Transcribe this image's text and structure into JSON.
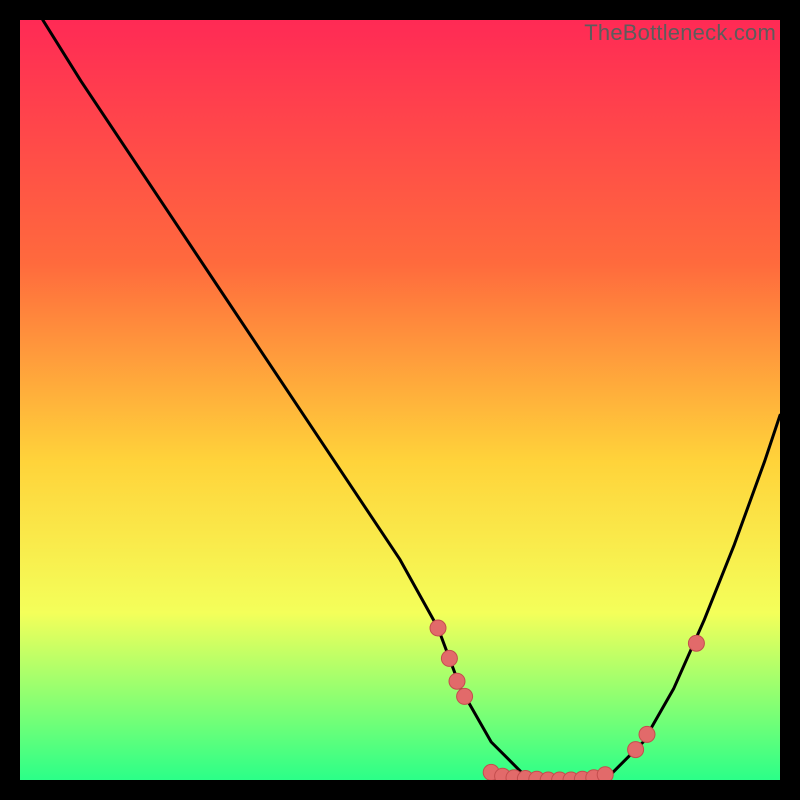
{
  "watermark": "TheBottleneck.com",
  "colors": {
    "bg_black": "#000000",
    "grad_top": "#ff2a55",
    "grad_mid1": "#ff6a3d",
    "grad_mid2": "#ffd33a",
    "grad_mid3": "#f4ff5a",
    "grad_bot": "#2bff88",
    "curve": "#000000",
    "marker_fill": "#e26a6a",
    "marker_stroke": "#c44d4d"
  },
  "chart_data": {
    "type": "line",
    "title": "",
    "xlabel": "",
    "ylabel": "",
    "xlim": [
      0,
      100
    ],
    "ylim": [
      0,
      100
    ],
    "grid": false,
    "curve": {
      "name": "bottleneck-curve",
      "x": [
        3,
        8,
        14,
        20,
        26,
        32,
        38,
        44,
        50,
        55,
        58,
        62,
        66,
        70,
        74,
        78,
        82,
        86,
        90,
        94,
        98,
        100
      ],
      "y": [
        100,
        92,
        83,
        74,
        65,
        56,
        47,
        38,
        29,
        20,
        12,
        5,
        1,
        0,
        0,
        1,
        5,
        12,
        21,
        31,
        42,
        48
      ]
    },
    "flat_region_x": [
      62,
      78
    ],
    "markers": [
      {
        "x": 55,
        "y": 20
      },
      {
        "x": 56.5,
        "y": 16
      },
      {
        "x": 57.5,
        "y": 13
      },
      {
        "x": 58.5,
        "y": 11
      },
      {
        "x": 62,
        "y": 1
      },
      {
        "x": 63.5,
        "y": 0.5
      },
      {
        "x": 65,
        "y": 0.3
      },
      {
        "x": 66.5,
        "y": 0.2
      },
      {
        "x": 68,
        "y": 0.1
      },
      {
        "x": 69.5,
        "y": 0
      },
      {
        "x": 71,
        "y": 0
      },
      {
        "x": 72.5,
        "y": 0
      },
      {
        "x": 74,
        "y": 0.1
      },
      {
        "x": 75.5,
        "y": 0.3
      },
      {
        "x": 77,
        "y": 0.7
      },
      {
        "x": 81,
        "y": 4
      },
      {
        "x": 82.5,
        "y": 6
      },
      {
        "x": 89,
        "y": 18
      }
    ]
  }
}
